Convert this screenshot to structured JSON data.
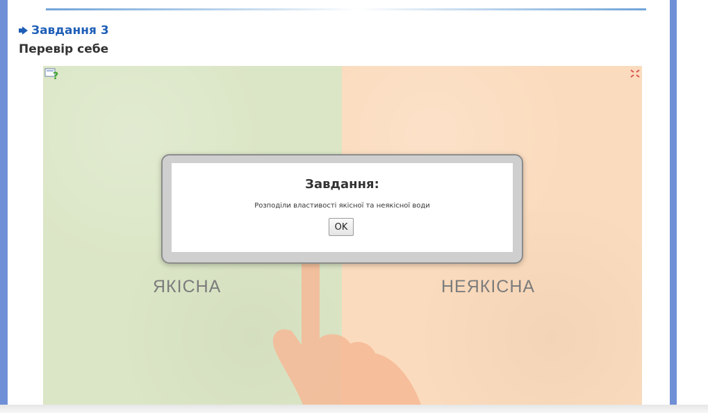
{
  "task": {
    "title": "Завдання 3",
    "subtitle": "Перевір себе"
  },
  "game": {
    "left_label": "ЯКІСНА",
    "right_label": "НЕЯКІСНА",
    "left_color": "#dbe6c6",
    "right_color": "#fbdbbd",
    "help_icon": "help-icon",
    "fullscreen_icon": "fullscreen-icon"
  },
  "dialog": {
    "title": "Завдання:",
    "text": "Розподіли властивості якісної та неякісної води",
    "ok_label": "OK"
  },
  "colors": {
    "accent": "#1f5fb7",
    "frame": "#6f8fd6"
  }
}
